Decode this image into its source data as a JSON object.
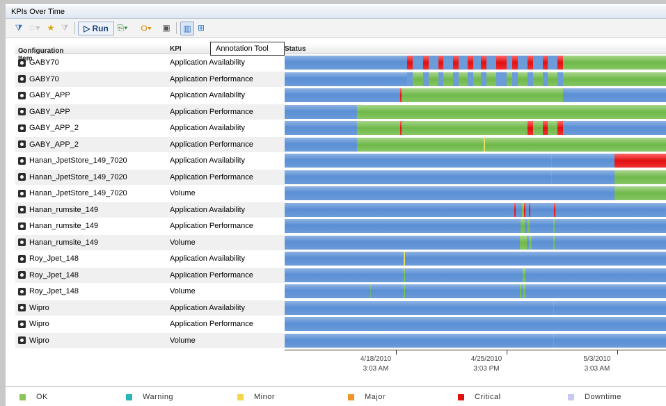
{
  "window": {
    "title": "KPIs Over Time"
  },
  "toolbar": {
    "run_label": "Run"
  },
  "columns": {
    "ci": "Configuration Item",
    "kpi": "KPI",
    "status": "Status"
  },
  "tooltip": "Annotation Tool",
  "rows": [
    {
      "ci": "GABY70",
      "kpi": "Application Availability"
    },
    {
      "ci": "GABY70",
      "kpi": "Application Performance"
    },
    {
      "ci": "GABY_APP",
      "kpi": "Application Availability"
    },
    {
      "ci": "GABY_APP",
      "kpi": "Application Performance"
    },
    {
      "ci": "GABY_APP_2",
      "kpi": "Application Availability"
    },
    {
      "ci": "GABY_APP_2",
      "kpi": "Application Performance"
    },
    {
      "ci": "Hanan_JpetStore_149_7020",
      "kpi": "Application Availability"
    },
    {
      "ci": "Hanan_JpetStore_149_7020",
      "kpi": "Application Performance"
    },
    {
      "ci": "Hanan_JpetStore_149_7020",
      "kpi": "Volume"
    },
    {
      "ci": "Hanan_rumsite_149",
      "kpi": "Application Availability"
    },
    {
      "ci": "Hanan_rumsite_149",
      "kpi": "Application Performance"
    },
    {
      "ci": "Hanan_rumsite_149",
      "kpi": "Volume"
    },
    {
      "ci": "Roy_Jpet_148",
      "kpi": "Application Availability"
    },
    {
      "ci": "Roy_Jpet_148",
      "kpi": "Application Performance"
    },
    {
      "ci": "Roy_Jpet_148",
      "kpi": "Volume"
    },
    {
      "ci": "Wipro",
      "kpi": "Application Availability"
    },
    {
      "ci": "Wipro",
      "kpi": "Application Performance"
    },
    {
      "ci": "Wipro",
      "kpi": "Volume"
    }
  ],
  "timeline": {
    "ticks": [
      {
        "date": "4/18/2010",
        "time": "3:03 AM"
      },
      {
        "date": "4/25/2010",
        "time": "3:03 PM"
      },
      {
        "date": "5/3/2010",
        "time": "3:03 AM"
      }
    ]
  },
  "legend": [
    {
      "label": "OK",
      "color": "#8cc45c"
    },
    {
      "label": "Warning",
      "color": "#2bb5b5"
    },
    {
      "label": "Minor",
      "color": "#f5d54a"
    },
    {
      "label": "Major",
      "color": "#f0952a"
    },
    {
      "label": "Critical",
      "color": "#e01010"
    },
    {
      "label": "Downtime",
      "color": "#c8c8f0"
    }
  ]
}
